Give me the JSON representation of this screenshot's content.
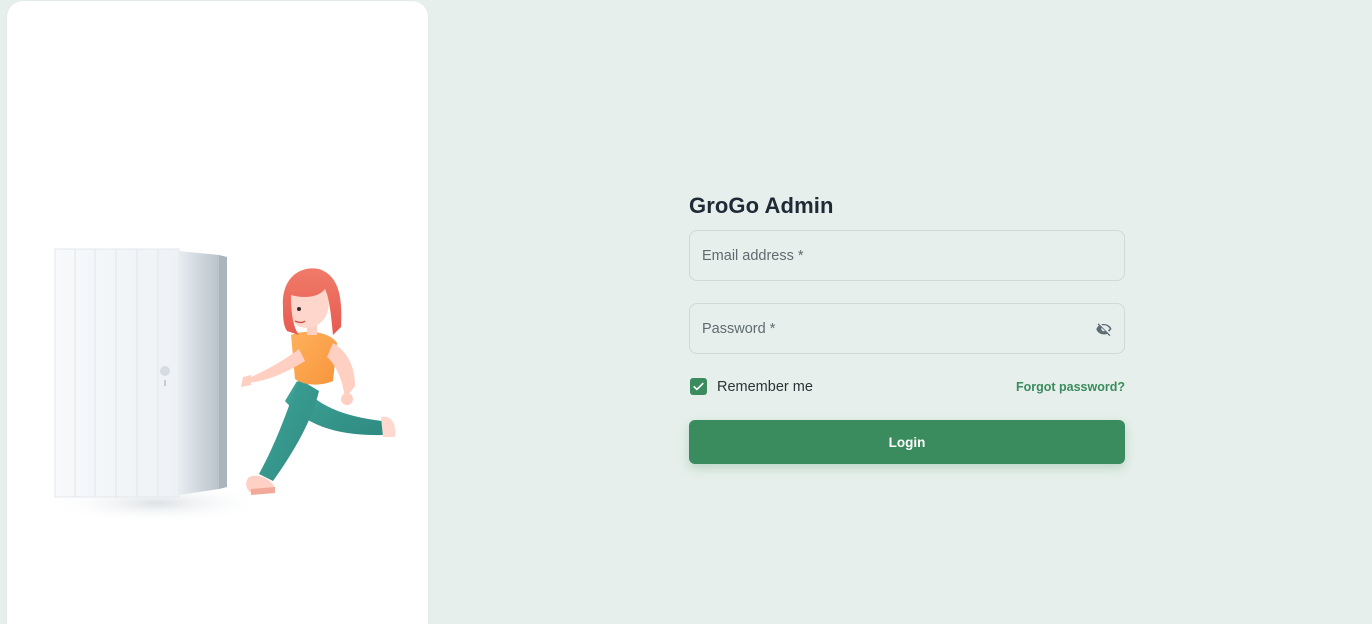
{
  "brand": {
    "title": "GroGo Admin",
    "accent_color": "#3a8b5d",
    "background_color": "#e6efeb"
  },
  "login_form": {
    "email_placeholder": "Email address *",
    "password_placeholder": "Password *",
    "password_toggle_icon": "eye-off-icon",
    "remember_label": "Remember me",
    "remember_checked": true,
    "forgot_label": "Forgot password?",
    "submit_label": "Login"
  },
  "illustration": {
    "subject": "girl-running-out-of-door-illustration"
  }
}
